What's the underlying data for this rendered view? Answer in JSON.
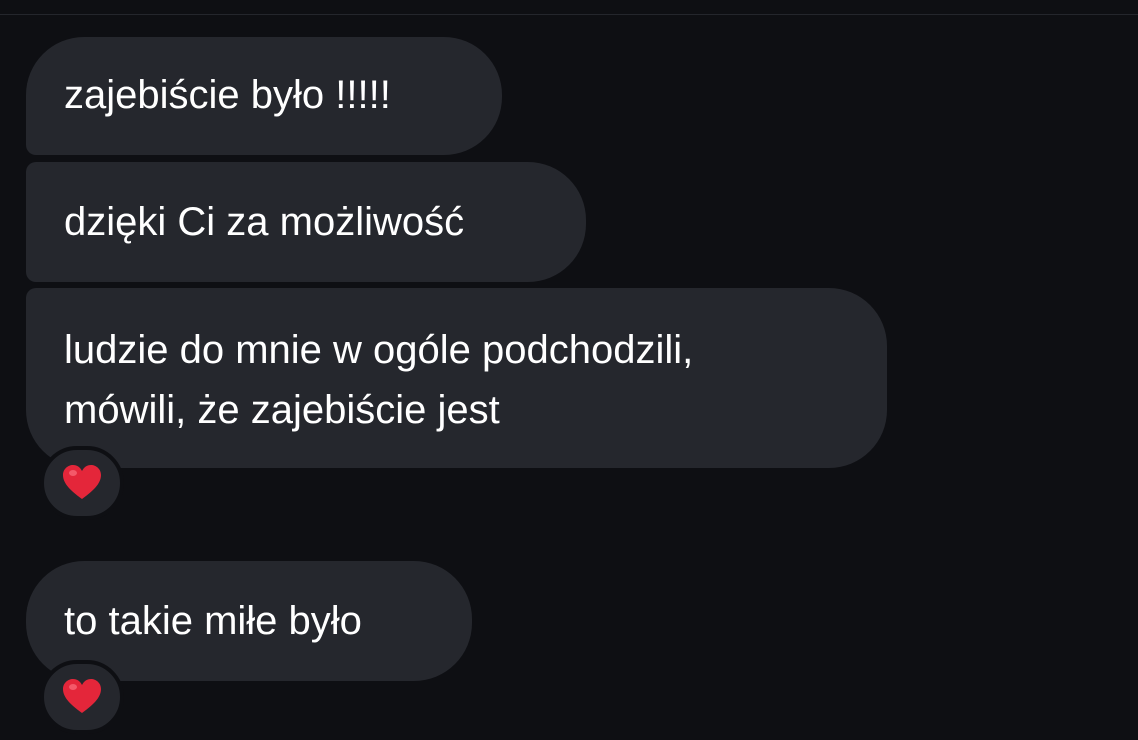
{
  "messages": [
    {
      "text_lines": [
        "zajebiście było !!!!!"
      ]
    },
    {
      "text_lines": [
        "dzięki Ci za możliwość"
      ]
    },
    {
      "text_lines": [
        "ludzie do mnie w ogóle podchodzili,",
        "mówili, że zajebiście jest"
      ],
      "reaction": "heart-icon"
    },
    {
      "text_lines": [
        "to takie miłe było"
      ],
      "reaction": "heart-icon"
    }
  ],
  "colors": {
    "background": "#0e0f13",
    "bubble": "#25272d",
    "text": "#ffffff",
    "heart": "#e4263a"
  }
}
